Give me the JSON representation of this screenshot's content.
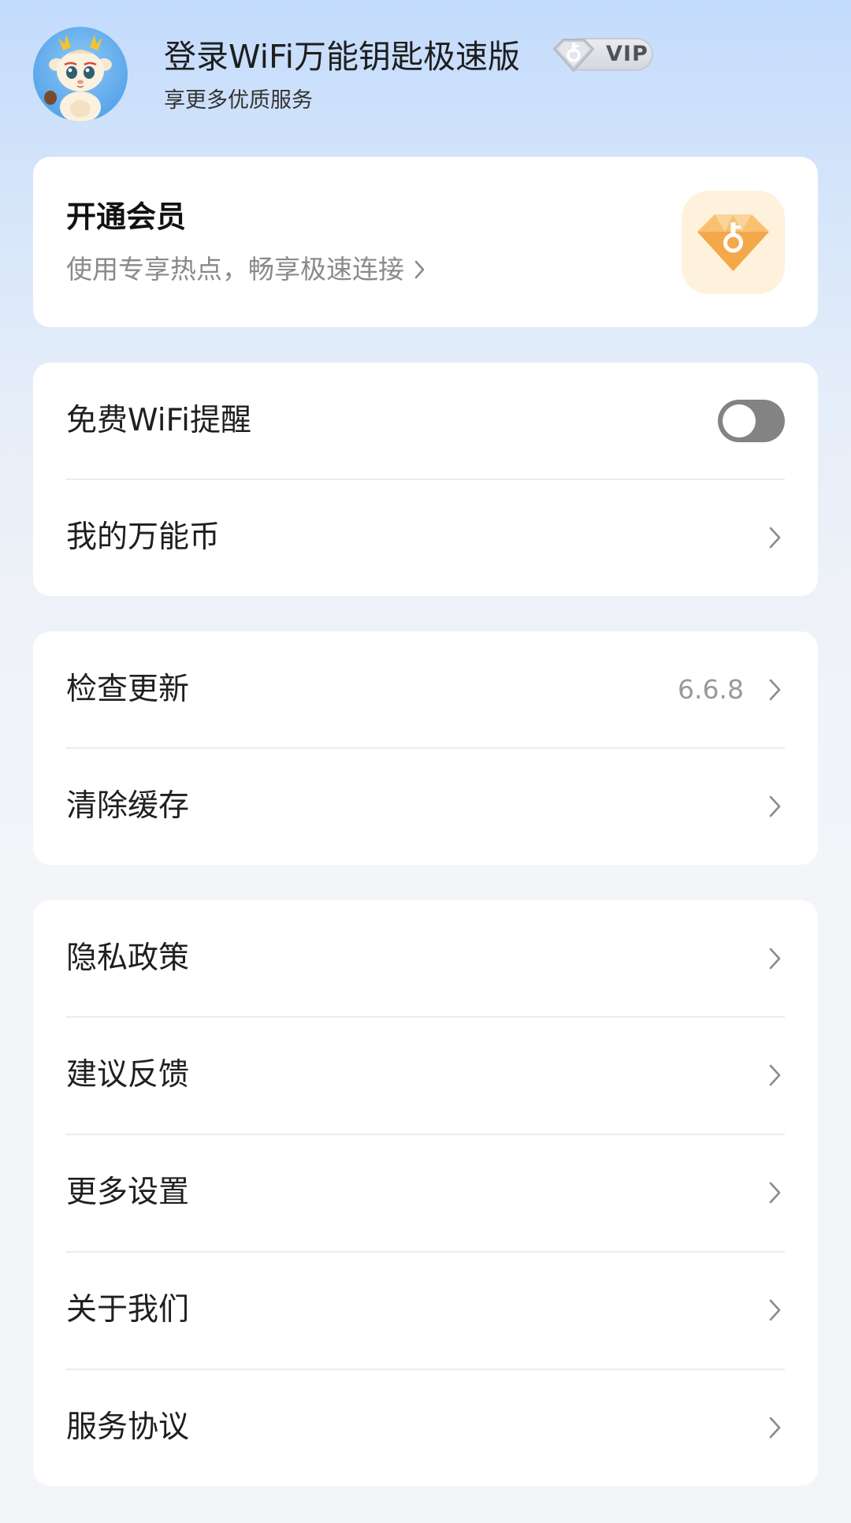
{
  "header": {
    "login_title": "登录WiFi万能钥匙极速版",
    "vip_label": "VIP",
    "subtitle": "享更多优质服务",
    "avatar_icon": "dragon-mascot-avatar",
    "vip_icon": "diamond-key-icon"
  },
  "member_card": {
    "title": "开通会员",
    "description": "使用专享热点，畅享极速连接",
    "icon": "diamond-key-icon",
    "accent_color": "#f6b24f"
  },
  "group_a": {
    "free_wifi_reminder": {
      "label": "免费WiFi提醒",
      "toggle_on": false
    },
    "my_coins": {
      "label": "我的万能币"
    }
  },
  "group_b": {
    "check_update": {
      "label": "检查更新",
      "value": "6.6.8"
    },
    "clear_cache": {
      "label": "清除缓存"
    }
  },
  "group_c": {
    "privacy_policy": {
      "label": "隐私政策"
    },
    "feedback": {
      "label": "建议反馈"
    },
    "more_settings": {
      "label": "更多设置"
    },
    "about_us": {
      "label": "关于我们"
    },
    "service_agreement": {
      "label": "服务协议"
    }
  },
  "colors": {
    "toggle_off": "#838383",
    "chevron": "#8a8a8a"
  }
}
